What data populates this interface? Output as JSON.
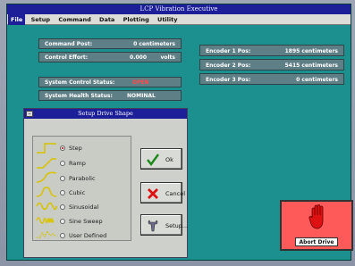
{
  "window": {
    "title": "LCP Vibration Executive"
  },
  "menu": [
    {
      "label": "File",
      "active": true
    },
    {
      "label": "Setup",
      "active": false
    },
    {
      "label": "Command",
      "active": false
    },
    {
      "label": "Data",
      "active": false
    },
    {
      "label": "Plotting",
      "active": false
    },
    {
      "label": "Utility",
      "active": false
    }
  ],
  "status": {
    "command_post_label": "Command Post:",
    "command_post_value": "0 centimeters",
    "control_effort_label": "Control Effort:",
    "control_effort_value": "0.000",
    "control_effort_unit": "volts",
    "system_control_label": "System Control Status:",
    "system_control_value": "OPEN",
    "system_health_label": "System Health Status:",
    "system_health_value": "NOMINAL"
  },
  "encoders": [
    {
      "label": "Encoder 1 Pos:",
      "value": "1895 centimeters"
    },
    {
      "label": "Encoder 2 Pos:",
      "value": "5415 centimeters"
    },
    {
      "label": "Encoder 3 Pos:",
      "value": "0 centimeters"
    }
  ],
  "dialog": {
    "title": "Setup Drive Shape",
    "system_menu": "–",
    "options": [
      {
        "label": "Step",
        "selected": true
      },
      {
        "label": "Ramp",
        "selected": false
      },
      {
        "label": "Parabolic",
        "selected": false
      },
      {
        "label": "Cubic",
        "selected": false
      },
      {
        "label": "Sinusoidal",
        "selected": false
      },
      {
        "label": "Sine Sweep",
        "selected": false
      },
      {
        "label": "User Defined",
        "selected": false
      }
    ],
    "ok_label": "Ok",
    "cancel_label": "Cancel",
    "setup_label": "Setup..."
  },
  "abort": {
    "label": "Abort Drive"
  },
  "colors": {
    "title_bar": "#1d1f99",
    "desktop": "#1c8f8f",
    "panel": "#5f7f86",
    "alert_value": "#ff4a4a",
    "abort_bg": "#ff5a5a"
  }
}
